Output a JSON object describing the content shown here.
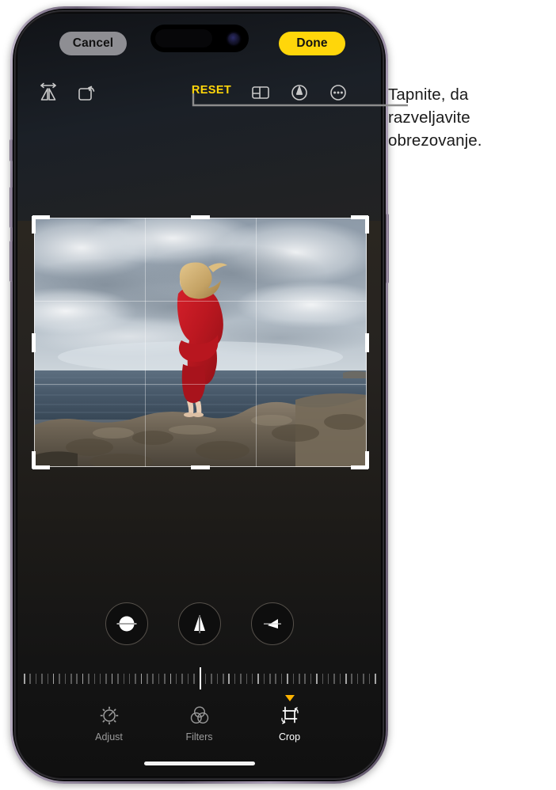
{
  "callout": {
    "text": "Tapnite, da razveljavite obrezovanje.",
    "line_color": "#8c8c8c"
  },
  "device": {
    "model": "iPhone",
    "home_indicator": "home-indicator"
  },
  "app": {
    "name": "Photos Editor",
    "mode": "Crop"
  },
  "topbar": {
    "cancel_label": "Cancel",
    "done_label": "Done",
    "done_color": "#ffd60a",
    "cancel_bg": "#8e8e93"
  },
  "toolbar": {
    "reset_label": "RESET",
    "reset_color": "#ffd60a",
    "items": [
      {
        "name": "flip-icon",
        "label": "Flip"
      },
      {
        "name": "rotate-icon",
        "label": "Rotate"
      },
      {
        "name": "aspect-ratio-icon",
        "label": "Aspect Ratio"
      },
      {
        "name": "markup-icon",
        "label": "Markup"
      },
      {
        "name": "more-options-icon",
        "label": "More"
      }
    ]
  },
  "photo": {
    "description": "Woman in a red dress standing on coastal rocks by the ocean under a cloudy sky",
    "crop_overlay": "rule-of-thirds-grid",
    "handles": 8
  },
  "geometry": {
    "buttons": [
      {
        "name": "straighten-button",
        "label": "Straighten"
      },
      {
        "name": "vertical-perspective-button",
        "label": "Vertical"
      },
      {
        "name": "horizontal-perspective-button",
        "label": "Horizontal"
      }
    ]
  },
  "ruler": {
    "value": "0",
    "center_index": 30,
    "tick_count": 61
  },
  "tabs": [
    {
      "name": "adjust",
      "label": "Adjust",
      "selected": false
    },
    {
      "name": "filters",
      "label": "Filters",
      "selected": false
    },
    {
      "name": "crop",
      "label": "Crop",
      "selected": true
    }
  ]
}
